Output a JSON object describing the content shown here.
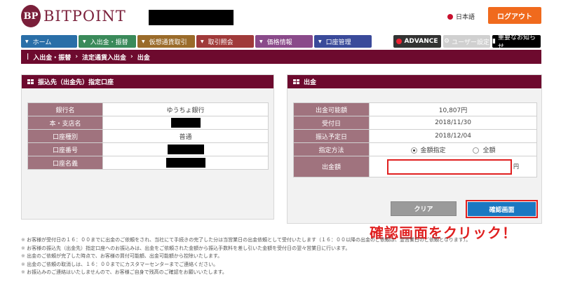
{
  "header": {
    "brand": "BITPOINT",
    "logo_mark": "BP",
    "language": "日本語",
    "logout": "ログアウト"
  },
  "nav": [
    {
      "label": "ホーム",
      "color": "#2a6fa8",
      "width": 80
    },
    {
      "label": "入出金・振替",
      "color": "#3a8a5a",
      "width": 82
    },
    {
      "label": "仮想通貨取引",
      "color": "#9a6b2a",
      "width": 82
    },
    {
      "label": "取引照会",
      "color": "#a03a3a",
      "width": 82
    },
    {
      "label": "価格情報",
      "color": "#8a4a8a",
      "width": 82
    },
    {
      "label": "口座管理",
      "color": "#3a4a9a",
      "width": 82
    }
  ],
  "tools": {
    "advance": "ADVANCE",
    "user_settings": "ユーザー設定",
    "important_news": "重要なお知らせ"
  },
  "breadcrumb": [
    "入出金・振替",
    "法定通貨入出金",
    "出金"
  ],
  "left_panel": {
    "title": "振込先（出金先）指定口座",
    "rows": [
      {
        "label": "銀行名",
        "value": "ゆうちょ銀行"
      },
      {
        "label": "本・支店名",
        "value": ""
      },
      {
        "label": "口座種別",
        "value": "普通"
      },
      {
        "label": "口座番号",
        "value": ""
      },
      {
        "label": "口座名義",
        "value": ""
      }
    ]
  },
  "right_panel": {
    "title": "出金",
    "rows": [
      {
        "label": "出金可能額",
        "value": "10,807円"
      },
      {
        "label": "受付日",
        "value": "2018/11/30"
      },
      {
        "label": "振込予定日",
        "value": "2018/12/04"
      }
    ],
    "method_label": "指定方法",
    "method_options": [
      {
        "label": "金額指定",
        "selected": true
      },
      {
        "label": "全額",
        "selected": false
      }
    ],
    "amount_label": "出金額",
    "amount_value": "",
    "amount_unit": "円",
    "clear_button": "クリア",
    "confirm_button": "確認画面"
  },
  "annotation": "確認画面をクリック！",
  "notes": [
    "お客様が受付日の１６：００までに出金のご依頼をされ、当社にて手続きの完了した分は当営業日の出金依頼として受付いたします（１６：００以降の出金のご依頼は、翌営業日のご依頼となります）。",
    "お客様の振込先（出金先）指定口座へのお振込みは、出金をご依頼された金額から振込手数料を差し引いた金額を受付日の翌々営業日に行います。",
    "出金のご依頼が完了した時点で、お客様の買付可能額、出金可能額から控除いたします。",
    "出金のご依頼の取消しは、１６：００までにカスタマーセンターまでご連絡ください。",
    "お振込みのご連絡はいたしませんので、お客様ご自身で残高のご確認をお願いいたします。"
  ]
}
